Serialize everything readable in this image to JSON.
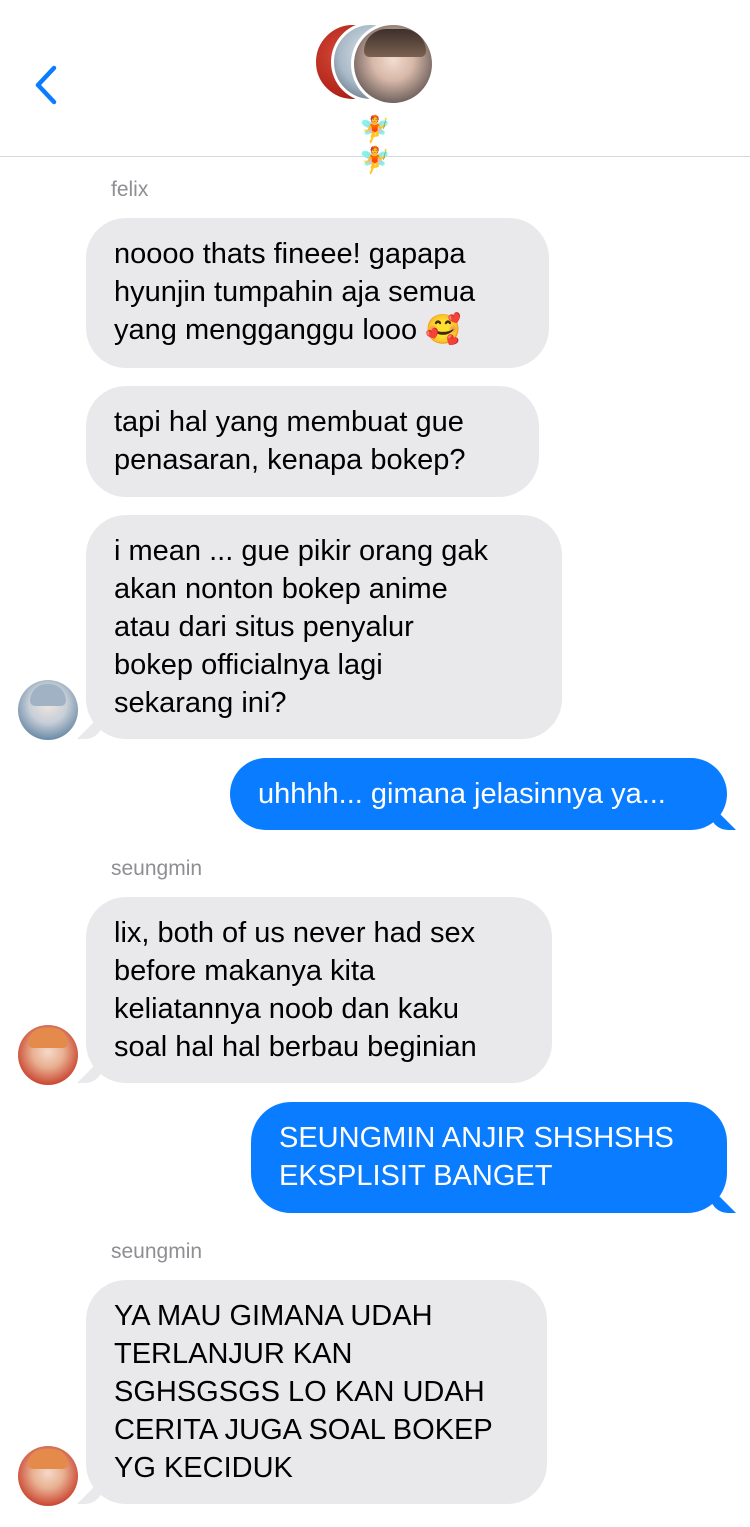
{
  "header": {
    "group_emoji": "🧚🧚",
    "back_icon": "chevron-left-icon",
    "accent": "#0a7cff"
  },
  "colors": {
    "incoming_bubble": "#e9e9eb",
    "outgoing_bubble": "#0a7cff",
    "sender_label": "#8e8e93"
  },
  "messages": [
    {
      "sender": "felix"
    },
    {
      "text": "noooo thats fineee! gapapa\nhyunjin tumpahin aja semua\nyang mengganggu looo 🥰"
    },
    {
      "text": "tapi hal yang membuat gue\npenasaran, kenapa bokep?"
    },
    {
      "text": "i mean ... gue pikir orang gak\nakan nonton bokep anime\natau dari situs penyalur\nbokep officialnya lagi\nsekarang ini?"
    },
    {
      "text": "uhhhh... gimana jelasinnya ya..."
    },
    {
      "sender": "seungmin"
    },
    {
      "text": "lix, both of us never had sex\nbefore makanya kita\nkeliatannya noob dan kaku\nsoal hal hal berbau beginian"
    },
    {
      "text": "SEUNGMIN ANJIR SHSHSHS\nEKSPLISIT BANGET"
    },
    {
      "sender": "seungmin"
    },
    {
      "text": "YA MAU GIMANA UDAH\nTERLANJUR KAN\nSGHSGSGS LO KAN UDAH\nCERITA JUGA SOAL BOKEP\nYG KECIDUK"
    }
  ]
}
